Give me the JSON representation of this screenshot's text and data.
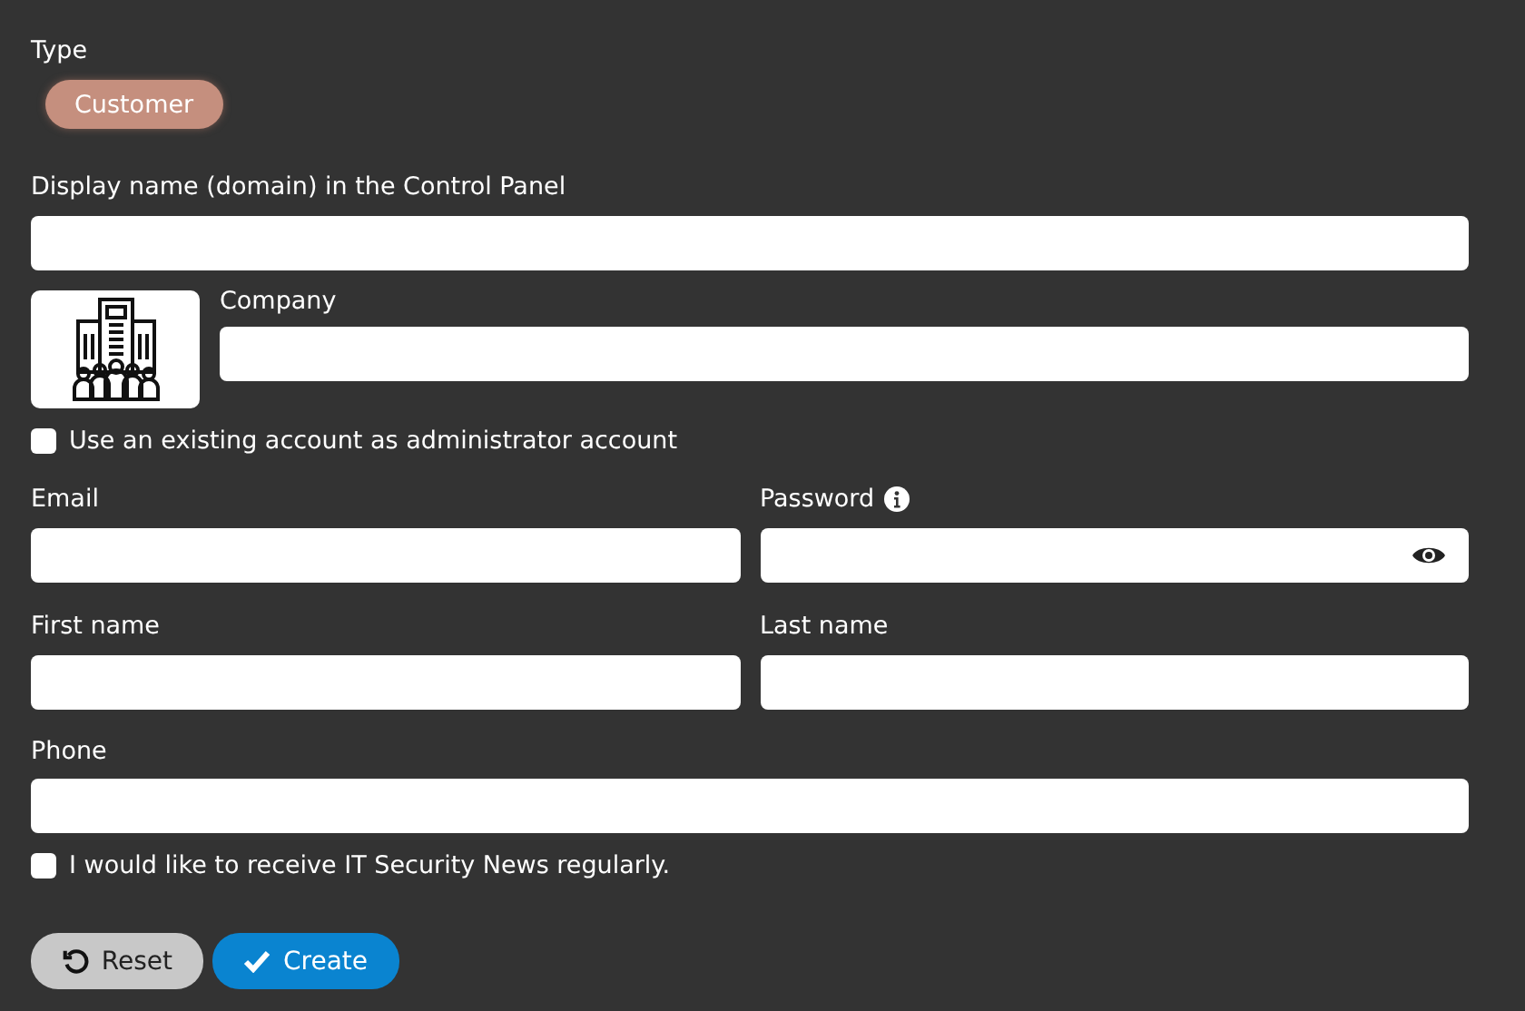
{
  "type": {
    "label": "Type",
    "options": [
      {
        "label": "Customer",
        "selected": true
      }
    ]
  },
  "display_name": {
    "label": "Display name (domain) in the Control Panel"
  },
  "company": {
    "label": "Company"
  },
  "use_existing": {
    "label": "Use an existing account as administrator account",
    "checked": false
  },
  "fields": [
    {
      "label": "Email",
      "kind": "text"
    },
    {
      "label": "Password",
      "kind": "password"
    },
    {
      "label": "First name",
      "kind": "text"
    },
    {
      "label": "Last name",
      "kind": "text"
    }
  ],
  "phone": {
    "label": "Phone"
  },
  "newsletter": {
    "label": "I would like to receive IT Security News regularly.",
    "checked": false
  },
  "buttons": [
    {
      "label": "Reset",
      "kind": "reset"
    },
    {
      "label": "Create",
      "kind": "create"
    }
  ]
}
